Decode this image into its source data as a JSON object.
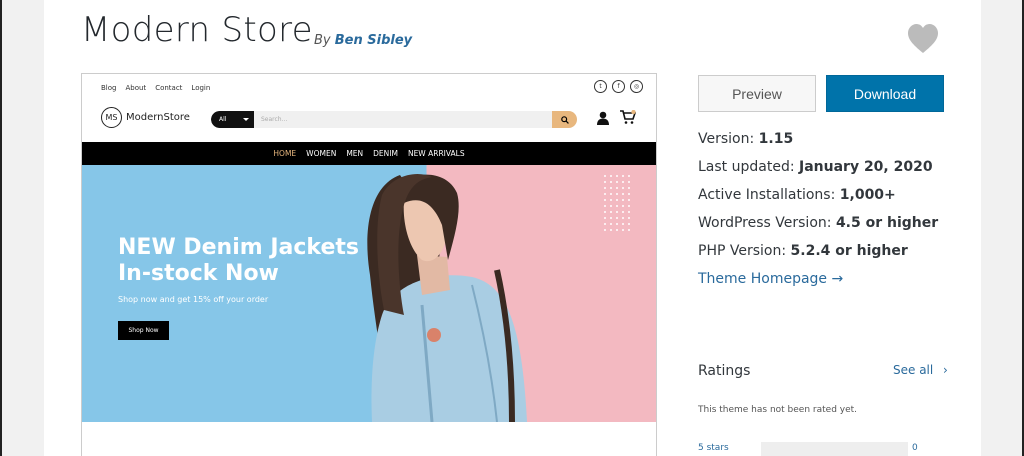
{
  "theme": {
    "title": "Modern Store",
    "by_prefix": "By",
    "author": "Ben Sibley"
  },
  "preview_site": {
    "top_links": [
      "Blog",
      "About",
      "Contact",
      "Login"
    ],
    "social_icons": [
      "twitter-icon",
      "facebook-icon",
      "instagram-icon"
    ],
    "logo_mark": "MS",
    "logo_name": "ModernStore",
    "search_category": "All",
    "search_placeholder": "Search...",
    "nav": [
      "HOME",
      "WOMEN",
      "MEN",
      "DENIM",
      "NEW ARRIVALS"
    ],
    "hero_heading_line1": "NEW Denim Jackets",
    "hero_heading_line2": "In-stock Now",
    "hero_sub": "Shop now and get 15% off your order",
    "hero_button": "Shop Now",
    "accent": "#e8b77e"
  },
  "actions": {
    "preview": "Preview",
    "download": "Download"
  },
  "meta": {
    "version_label": "Version:",
    "version": "1.15",
    "updated_label": "Last updated:",
    "updated": "January 20, 2020",
    "installs_label": "Active Installations:",
    "installs": "1,000+",
    "wp_label": "WordPress Version:",
    "wp": "4.5 or higher",
    "php_label": "PHP Version:",
    "php": "5.2.4 or higher",
    "homepage_link": "Theme Homepage →"
  },
  "ratings": {
    "heading": "Ratings",
    "see_all": "See all",
    "not_rated": "This theme has not been rated yet.",
    "rows": [
      {
        "label": "5 stars",
        "count": "0"
      }
    ]
  },
  "colors": {
    "link": "#2a6a9c",
    "download_bg": "#0073aa"
  }
}
